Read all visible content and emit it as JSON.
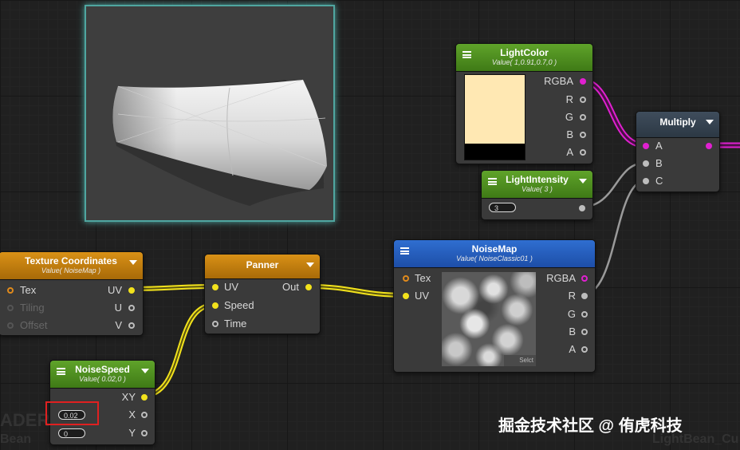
{
  "nodes": {
    "light_color": {
      "title": "LightColor",
      "subtitle": "Value( 1,0.91,0.7,0 )",
      "outputs": [
        "RGBA",
        "R",
        "G",
        "B",
        "A"
      ]
    },
    "multiply": {
      "title": "Multiply",
      "inputs": [
        "A",
        "B",
        "C"
      ]
    },
    "light_intensity": {
      "title": "LightIntensity",
      "subtitle": "Value( 3 )",
      "value": "3"
    },
    "texture_coordinates": {
      "title": "Texture Coordinates",
      "subtitle": "Value( NoiseMap )",
      "inputs": [
        "Tex",
        "Tiling",
        "Offset"
      ],
      "outputs": [
        "UV",
        "U",
        "V"
      ]
    },
    "panner": {
      "title": "Panner",
      "inputs": [
        "UV",
        "Speed",
        "Time"
      ],
      "outputs": [
        "Out"
      ]
    },
    "noise_map": {
      "title": "NoiseMap",
      "subtitle": "Value( NoiseClassic01 )",
      "inputs": [
        "Tex",
        "UV"
      ],
      "outputs": [
        "RGBA",
        "R",
        "G",
        "B",
        "A"
      ],
      "select_label": "Selct"
    },
    "noise_speed": {
      "title": "NoiseSpeed",
      "subtitle": "Value( 0.02,0 )",
      "outputs": [
        "XY",
        "X",
        "Y"
      ],
      "x_value": "0.02",
      "y_value": "0"
    }
  },
  "background_labels": {
    "left_top": "ADER",
    "left_bottom": "Bean",
    "right_bottom": "LightBean_Cu"
  },
  "watermark": "掘金技术社区 @ 侑虎科技",
  "colors": {
    "wire_yellow": "#f2e21c",
    "wire_magenta": "#e020d0",
    "wire_gray": "#9a9a9a",
    "highlight_box": "#e02020",
    "preview_border": "#4fa6a0"
  }
}
